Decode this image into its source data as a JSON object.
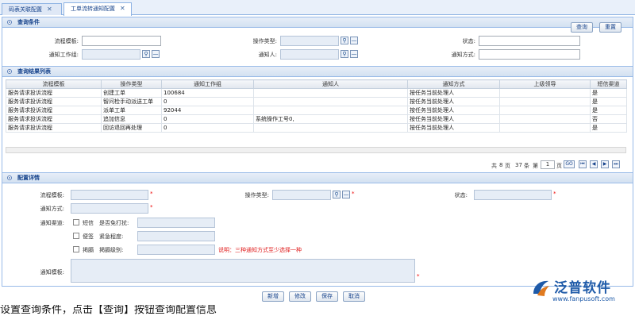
{
  "tabs": [
    {
      "label": "码表关联配置"
    },
    {
      "label": "工单流转通知配置"
    }
  ],
  "query": {
    "title": "查询条件",
    "labels": {
      "template": "流程模板:",
      "op_type": "操作类型:",
      "status": "状态:",
      "group": "通知工作组:",
      "person": "通知人:",
      "method": "通知方式:"
    },
    "search_btn": "查询",
    "reset_btn": "重置"
  },
  "results": {
    "title": "查询结果列表",
    "columns": [
      "流程模板",
      "操作类型",
      "通知工作组",
      "通知人",
      "通知方式",
      "上级领导",
      "短信渠道"
    ],
    "rows": [
      [
        "服务请求投诉流程",
        "创建工单",
        "100684",
        "",
        "按任务当前处理人",
        "",
        "是"
      ],
      [
        "服务请求投诉流程",
        "智问检手动派送工单",
        "0",
        "",
        "按任务当前处理人",
        "",
        "是"
      ],
      [
        "服务请求投诉流程",
        "派单工单",
        "92044",
        "",
        "按任务当前处理人",
        "",
        "是"
      ],
      [
        "服务请求投诉流程",
        "追加信息",
        "0",
        "系统操作工号0,",
        "按任务当前处理人",
        "",
        "否"
      ],
      [
        "服务请求投诉流程",
        "回访退回再处理",
        "0",
        "",
        "按任务当前处理人",
        "",
        "是"
      ]
    ],
    "pager": {
      "prefix": "共",
      "pages": "8",
      "page_unit": "页",
      "total": "37",
      "total_unit": "条",
      "at": "第",
      "current": "1",
      "current_unit": "页",
      "go": "GO"
    }
  },
  "detail": {
    "title": "配置详情",
    "labels": {
      "template": "流程模板:",
      "op_type": "操作类型:",
      "status": "状态:",
      "method": "通知方式:",
      "channel": "通知渠道:",
      "template2": "通知模板:"
    },
    "channels": [
      {
        "check": "短信",
        "field": "是否免打扰:"
      },
      {
        "check": "便签",
        "field": "紧急程度:"
      },
      {
        "check": "掲膈",
        "field": "掲膈级别:"
      }
    ],
    "note": "说明：三种通知方式至少选择一种",
    "required_mark": "*"
  },
  "actions": {
    "add": "新增",
    "edit": "修改",
    "save": "保存",
    "cancel": "取消"
  },
  "logo": {
    "name": "泛普软件",
    "url": "www.fanpusoft.com"
  },
  "bottom_text": "设置查询条件，点击【查询】按钮查询配置信息"
}
